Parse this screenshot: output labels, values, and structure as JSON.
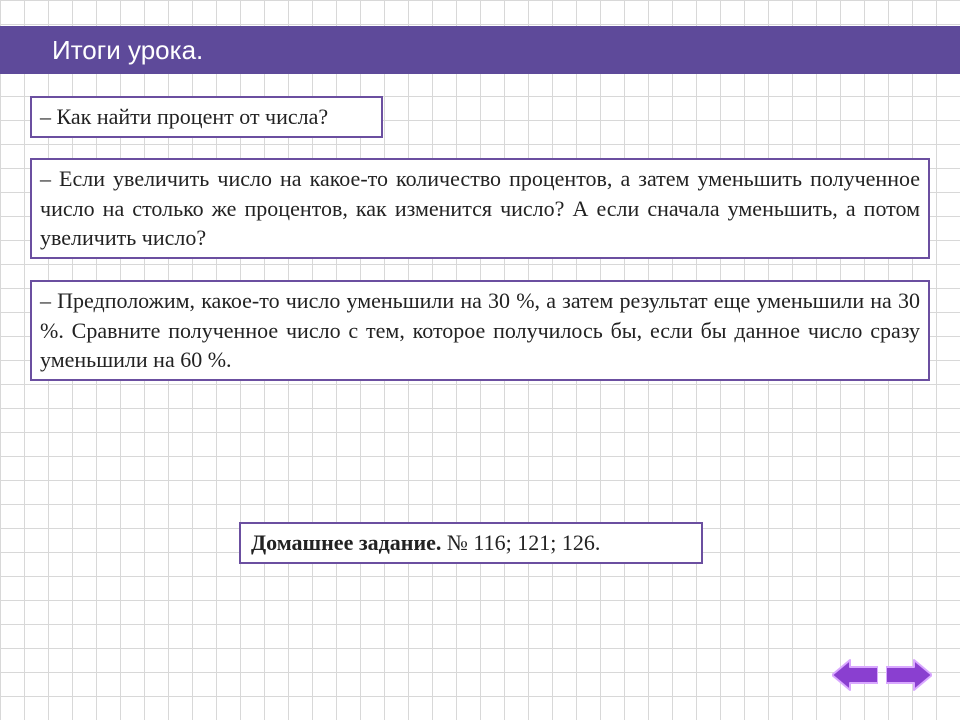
{
  "header": {
    "title": "Итоги урока."
  },
  "boxes": {
    "q1": "– Как найти процент от числа?",
    "q2": "– Если увеличить число на какое-то количество процентов, а затем уменьшить полученное число на столько же процентов, как изменится число? А если сначала уменьшить, а потом увеличить число?",
    "q3": "– Предположим, какое-то число уменьшили на 30 %, а затем результат еще уменьшили на 30 %. Сравните полученное число с тем, которое получилось бы, если бы данное число сразу уменьшили на 60 %.",
    "hw_label": "Домашнее задание.",
    "hw_numbers": "  № 116;  121;  126."
  },
  "colors": {
    "accent": "#5e4a9a",
    "arrow_fill": "#8a3fd0",
    "arrow_stroke": "#e0b0ff"
  }
}
